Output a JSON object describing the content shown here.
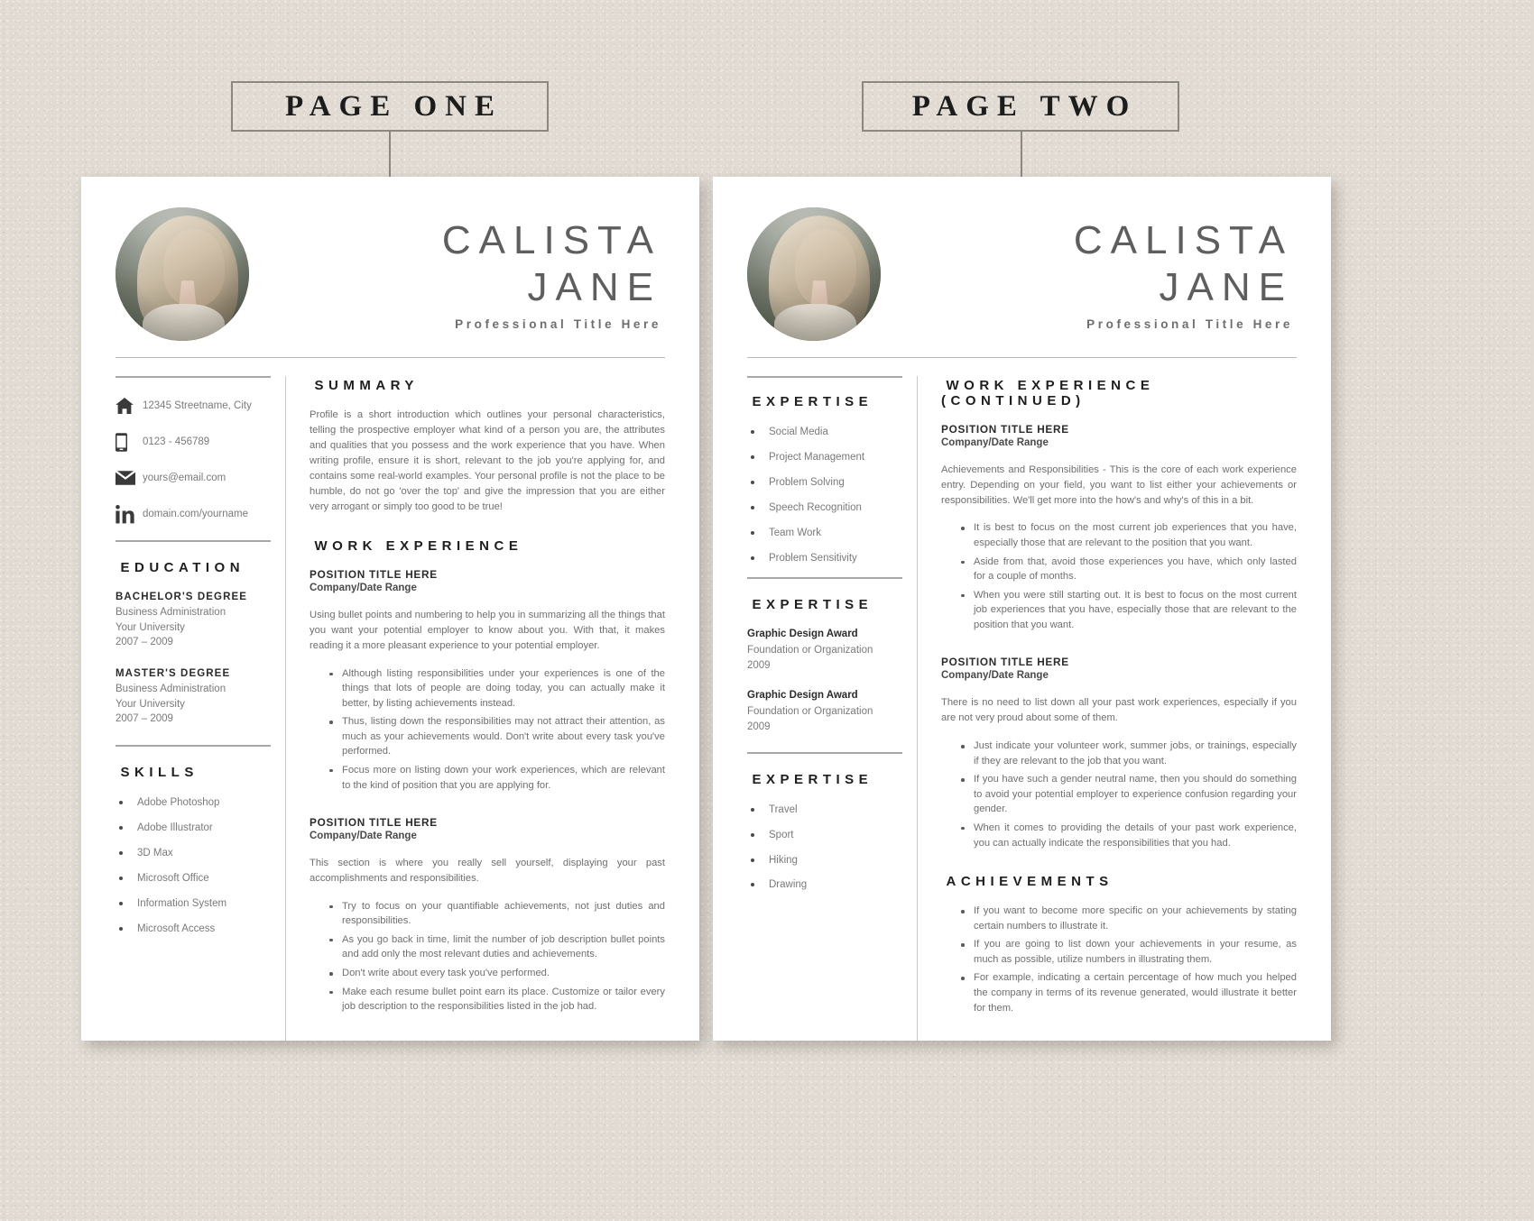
{
  "canvas": {
    "background_color": "#e1dbd3",
    "page_color": "#ffffff"
  },
  "badges": {
    "page_one": "PAGE ONE",
    "page_two": "PAGE TWO"
  },
  "header": {
    "first_name": "CALISTA",
    "last_name": "JANE",
    "professional_title": "Professional Title Here",
    "avatar_alt": "portrait-photo"
  },
  "contact": {
    "items": [
      {
        "icon": "home-icon",
        "value": "12345 Streetname, City"
      },
      {
        "icon": "phone-icon",
        "value": "0123 - 456789"
      },
      {
        "icon": "envelope-icon",
        "value": "yours@email.com"
      },
      {
        "icon": "linkedin-icon",
        "value": "domain.com/yourname"
      }
    ]
  },
  "education": {
    "title": "EDUCATION",
    "items": [
      {
        "degree": "BACHELOR'S DEGREE",
        "field": "Business Administration",
        "school": "Your University",
        "years": "2007 – 2009"
      },
      {
        "degree": "MASTER'S DEGREE",
        "field": "Business Administration",
        "school": "Your University",
        "years": "2007 – 2009"
      }
    ]
  },
  "skills": {
    "title": "SKILLS",
    "items": [
      "Adobe Photoshop",
      "Adobe Illustrator",
      "3D Max",
      "Microsoft Office",
      "Information System",
      "Microsoft Access"
    ]
  },
  "summary": {
    "title": "SUMMARY",
    "text": "Profile is a short introduction which outlines your personal characteristics, telling the prospective employer what kind of a person you are, the attributes and qualities that you possess and the work experience that you have. When writing profile, ensure it is short, relevant to the job you're applying for, and contains some real-world examples. Your personal profile is not the place to be humble, do not go 'over the top' and give the impression that you are either very arrogant or simply too good to be true!"
  },
  "work_experience": {
    "title": "WORK EXPERIENCE",
    "jobs": [
      {
        "title": "POSITION TITLE HERE",
        "company": "Company/Date Range",
        "intro": "Using bullet points and numbering to help you in summarizing all the things that you want your potential employer to know about you. With that, it makes reading it a more pleasant experience to your potential employer.",
        "bullets": [
          "Although listing responsibilities under your experiences is one of the things that lots of people are doing today, you can actually make it better, by listing achievements instead.",
          "Thus, listing down the responsibilities may not attract their attention, as much as your achievements would. Don't write about every task you've performed.",
          "Focus more on listing down your work experiences, which are relevant to the kind of position that you are applying for."
        ]
      },
      {
        "title": "POSITION TITLE HERE",
        "company": "Company/Date Range",
        "intro": "This section is where you really sell yourself, displaying your past accomplishments and responsibilities.",
        "bullets": [
          "Try to focus on your quantifiable achievements, not just duties and responsibilities.",
          "As you go back in time, limit the number of job description bullet points and add only the most relevant duties and achievements.",
          "Don't write about every task you've performed.",
          "Make each resume bullet point earn its place. Customize or tailor every job description to the responsibilities listed in the job had."
        ]
      }
    ]
  },
  "page_two": {
    "expertise_skills": {
      "title": "EXPERTISE",
      "items": [
        "Social Media",
        "Project Management",
        "Problem Solving",
        "Speech Recognition",
        "Team Work",
        "Problem Sensitivity"
      ]
    },
    "expertise_awards": {
      "title": "EXPERTISE",
      "items": [
        {
          "name": "Graphic Design Award",
          "organization": "Foundation or Organization",
          "year": "2009"
        },
        {
          "name": "Graphic Design Award",
          "organization": "Foundation or Organization",
          "year": "2009"
        }
      ]
    },
    "expertise_interests": {
      "title": "EXPERTISE",
      "items": [
        "Travel",
        "Sport",
        "Hiking",
        "Drawing"
      ]
    },
    "work_experience": {
      "title": "WORK EXPERIENCE (CONTINUED)",
      "jobs": [
        {
          "title": "POSITION TITLE HERE",
          "company": "Company/Date Range",
          "intro": "Achievements and Responsibilities - This is the core of each work experience entry. Depending on your field, you want to list either your achievements or responsibilities. We'll get more into the how's and why's of this in a bit.",
          "bullets": [
            "It is best to focus on the most current job experiences that you have, especially those that are relevant to the position that you want.",
            "Aside from that, avoid those experiences you have, which only lasted for a couple of months.",
            "When you were still starting out. It is best to focus on the most current job experiences that you have, especially those that are relevant to the position that you want."
          ]
        },
        {
          "title": "POSITION TITLE HERE",
          "company": "Company/Date Range",
          "intro": "There is no need to list down all your past work experiences, especially if you are not very proud about some of them.",
          "bullets": [
            "Just indicate your volunteer work, summer jobs, or trainings, especially if they are relevant to the job that you want.",
            "If you have such a gender neutral name, then you should do something to avoid your potential employer to experience confusion regarding your gender.",
            "When it comes to providing the details of your past work experience, you can actually indicate the responsibilities that you had."
          ]
        }
      ]
    },
    "achievements": {
      "title": "ACHIEVEMENTS",
      "bullets": [
        "If you want to become more specific on your achievements by stating certain numbers to illustrate it.",
        "If you are going to list down your achievements in your resume, as much as possible, utilize numbers in illustrating them.",
        "For example, indicating a certain percentage of how much you helped the company in terms of its revenue generated, would illustrate it better for them."
      ]
    }
  }
}
